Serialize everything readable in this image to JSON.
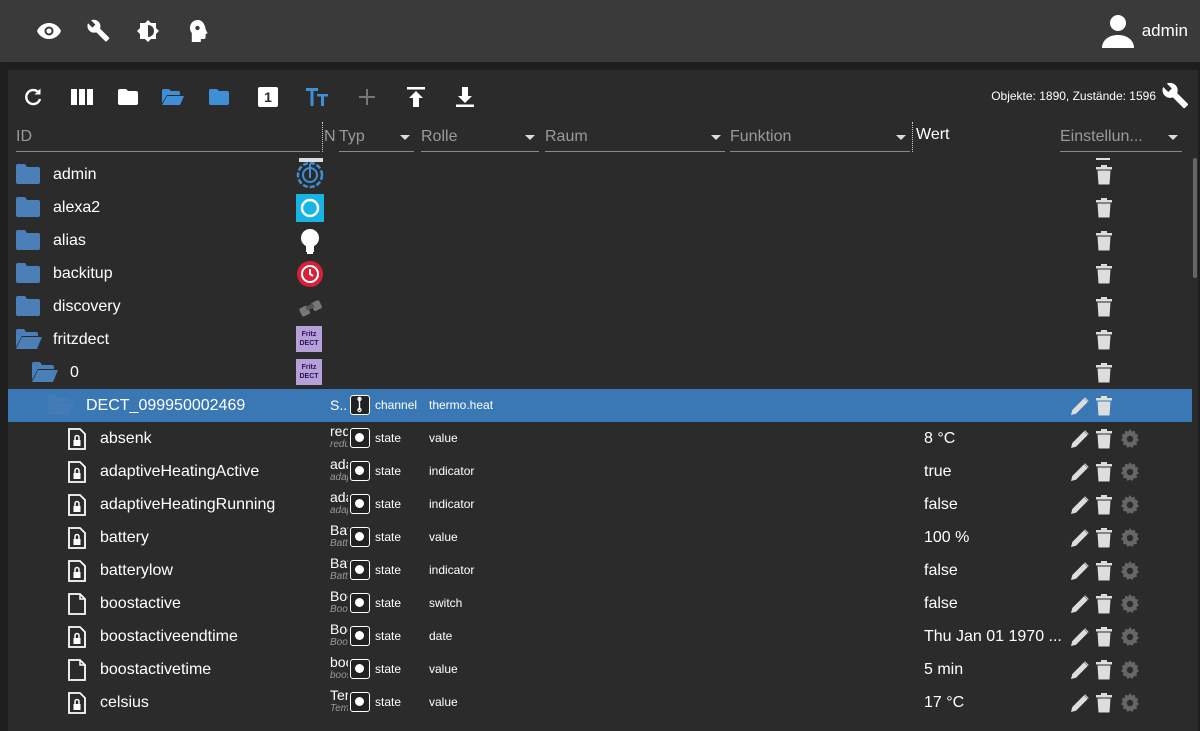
{
  "user": {
    "name": "admin"
  },
  "toolbar": {
    "stats": "Objekte: 1890, Zustände: 1596",
    "number_badge": "1"
  },
  "header": {
    "id": "ID",
    "name_short": "N",
    "typ": "Typ",
    "rolle": "Rolle",
    "raum": "Raum",
    "funktion": "Funktion",
    "wert": "Wert",
    "einstellungen": "Einstellun..."
  },
  "rows": [
    {
      "name": "admin",
      "level": 0,
      "folder": "closed",
      "icon": "admin-gear-icon"
    },
    {
      "name": "alexa2",
      "level": 0,
      "folder": "closed",
      "icon": "alexa-icon"
    },
    {
      "name": "alias",
      "level": 0,
      "folder": "closed",
      "icon": "bulb-icon"
    },
    {
      "name": "backitup",
      "level": 0,
      "folder": "closed",
      "icon": "backup-icon"
    },
    {
      "name": "discovery",
      "level": 0,
      "folder": "closed",
      "icon": "binoculars-icon"
    },
    {
      "name": "fritzdect",
      "level": 0,
      "folder": "open",
      "icon": "fritz-dect-icon"
    },
    {
      "name": "0",
      "level": 1,
      "folder": "open",
      "icon": "fritz-dect-icon"
    },
    {
      "name": "DECT_099950002469",
      "level": 2,
      "folder": "open",
      "sname": "S..",
      "type": "channel",
      "role": "thermo.heat",
      "selected": true
    },
    {
      "name": "absenk",
      "level": 3,
      "file": "locked",
      "sname": "reduzierte",
      "sdesc": "reduziert",
      "type": "state",
      "role": "value",
      "value": "8 °C"
    },
    {
      "name": "adaptiveHeatingActive",
      "level": 3,
      "file": "locked",
      "sname": "adaptive",
      "sdesc": "adaptive",
      "type": "state",
      "role": "indicator",
      "value": "true"
    },
    {
      "name": "adaptiveHeatingRunning",
      "level": 3,
      "file": "locked",
      "sname": "adaptive",
      "sdesc": "adaptive",
      "type": "state",
      "role": "indicator",
      "value": "false"
    },
    {
      "name": "battery",
      "level": 3,
      "file": "locked",
      "sname": "Batterie",
      "sdesc": "Batterie",
      "type": "state",
      "role": "value",
      "value": "100 %"
    },
    {
      "name": "batterylow",
      "level": 3,
      "file": "locked",
      "sname": "Batterie",
      "sdesc": "Batterie",
      "type": "state",
      "role": "indicator",
      "value": "false"
    },
    {
      "name": "boostactive",
      "level": 3,
      "file": "plain",
      "sname": "Boost",
      "sdesc": "Boost",
      "type": "state",
      "role": "switch",
      "value": "false"
    },
    {
      "name": "boostactiveendtime",
      "level": 3,
      "file": "locked",
      "sname": "Boost",
      "sdesc": "Boost",
      "type": "state",
      "role": "date",
      "value": "Thu Jan 01 1970 ..."
    },
    {
      "name": "boostactivetime",
      "level": 3,
      "file": "plain",
      "sname": "boost",
      "sdesc": "boost",
      "type": "state",
      "role": "value",
      "value": "5 min"
    },
    {
      "name": "celsius",
      "level": 3,
      "file": "locked",
      "sname": "Temperatur",
      "sdesc": "Temperatur",
      "type": "state",
      "role": "value",
      "value": "17 °C"
    }
  ]
}
